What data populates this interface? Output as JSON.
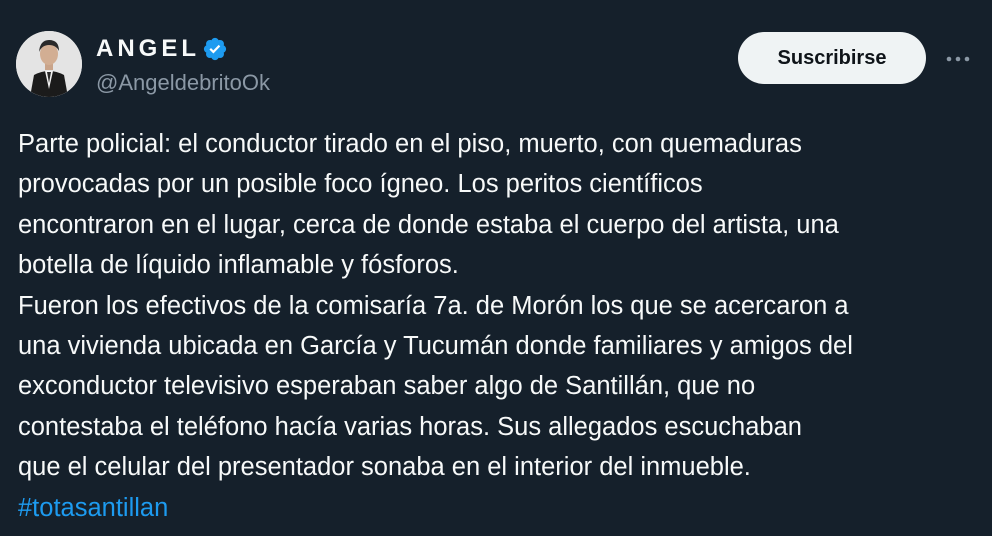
{
  "author": {
    "display_name": "ANGEL",
    "handle": "@AngeldebritoOk",
    "verified_icon": "verified-badge-icon",
    "verified_color": "#1d9bf0"
  },
  "actions": {
    "subscribe_label": "Suscribirse",
    "more_icon": "more-dots-icon"
  },
  "tweet": {
    "lines": [
      "Parte policial: el conductor tirado en el piso, muerto, con quemaduras",
      "provocadas por un posible foco ígneo. Los peritos científicos",
      "encontraron en el lugar, cerca de donde estaba el cuerpo del artista, una",
      "botella de líquido inflamable y fósforos.",
      "Fueron los efectivos de la comisaría 7a. de Morón los que se acercaron a",
      "una vivienda ubicada en García y Tucumán donde familiares y amigos del",
      "exconductor televisivo esperaban saber algo de Santillán, que no",
      "contestaba el teléfono hacía varias horas. Sus allegados escuchaban",
      "que el celular del presentador sonaba en el interior del inmueble."
    ],
    "hashtag": "#totasantillan"
  },
  "colors": {
    "background": "#15202b",
    "text": "#f7f9f9",
    "secondary": "#8b98a5",
    "link": "#1d9bf0"
  }
}
